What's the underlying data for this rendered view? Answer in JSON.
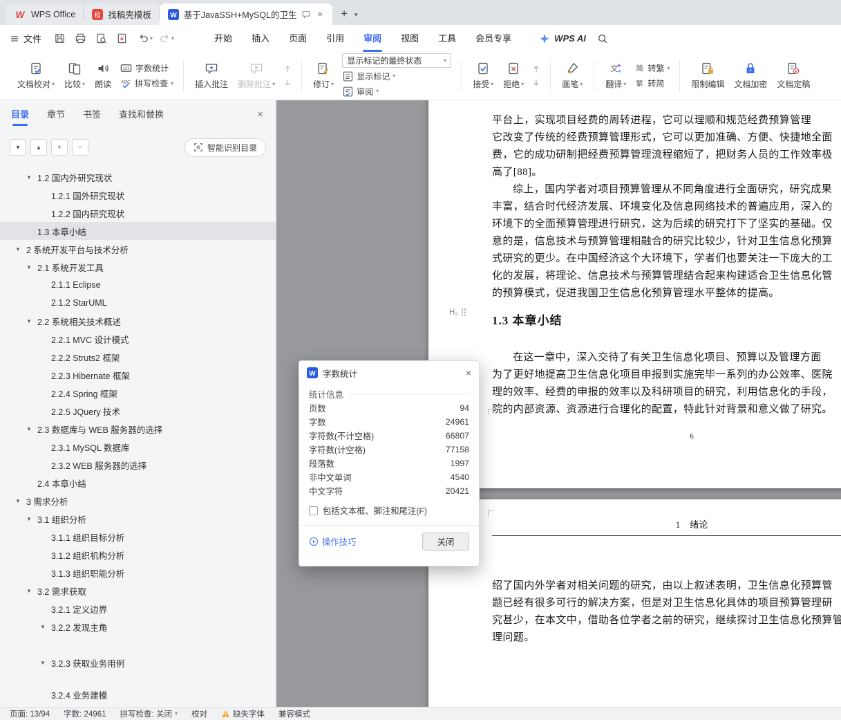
{
  "colors": {
    "accent": "#3C6EF0",
    "writer_blue": "#2A5CDC",
    "wps_red": "#E33E38",
    "warning": "#F5A623",
    "canvas": "#97999C"
  },
  "titlebar": {
    "tabs": [
      {
        "id": "wps-home",
        "icon": "wps",
        "label": "WPS Office"
      },
      {
        "id": "docer-template",
        "icon": "docer",
        "label": "找稿壳模板"
      },
      {
        "id": "document",
        "icon": "writer",
        "label": "基于JavaSSH+MySQL的卫生",
        "active": true,
        "bubble": true,
        "closable": true
      }
    ],
    "new_tab_glyph": "+",
    "tabs_chevron_glyph": "▾"
  },
  "menubar": {
    "file_label": "文件",
    "quick": [
      "save",
      "print",
      "preview",
      "export"
    ],
    "tabs": [
      {
        "label": "开始"
      },
      {
        "label": "插入"
      },
      {
        "label": "页面"
      },
      {
        "label": "引用"
      },
      {
        "label": "审阅",
        "active": true
      },
      {
        "label": "视图"
      },
      {
        "label": "工具"
      },
      {
        "label": "会员专享"
      }
    ],
    "wps_ai_label": "WPS AI"
  },
  "ribbon": {
    "groups": [
      {
        "blocks": [
          {
            "t": "big",
            "icon": "proof",
            "label": "文档校对",
            "chev": true
          },
          {
            "t": "big",
            "icon": "compare",
            "label": "比较",
            "chev": true
          },
          {
            "t": "big",
            "icon": "speaker",
            "label": "朗读"
          },
          {
            "t": "stack",
            "rows": [
              {
                "icon": "count",
                "label": "字数统计"
              },
              {
                "icon": "spell",
                "label": "拼写检查",
                "chev": true
              }
            ]
          }
        ]
      },
      {
        "blocks": [
          {
            "t": "big",
            "icon": "bubble-add",
            "label": "插入批注"
          },
          {
            "t": "big",
            "icon": "bubble-del",
            "label": "删除批注",
            "chev": true,
            "disabled": true
          },
          {
            "t": "navpair",
            "icons": [
              "prev-comment",
              "next-comment"
            ]
          }
        ]
      },
      {
        "blocks": [
          {
            "t": "big",
            "icon": "revise",
            "label": "修订",
            "chev": true
          },
          {
            "t": "stack",
            "rows": [
              {
                "combo": true,
                "label": "显示标记的最终状态"
              },
              {
                "icon": "markup",
                "label": "显示标记",
                "chev": true
              },
              {
                "icon": "review",
                "label": "审阅",
                "chev": true
              }
            ]
          }
        ]
      },
      {
        "blocks": [
          {
            "t": "big",
            "icon": "accept",
            "label": "接受",
            "chev": true
          },
          {
            "t": "big",
            "icon": "reject",
            "label": "拒绝",
            "chev": true
          },
          {
            "t": "navpair",
            "icons": [
              "prev-change",
              "next-change"
            ]
          }
        ]
      },
      {
        "blocks": [
          {
            "t": "big",
            "icon": "brush",
            "label": "画笔",
            "chev": true
          }
        ]
      },
      {
        "blocks": [
          {
            "t": "big",
            "icon": "translate",
            "label": "翻译",
            "chev": true
          },
          {
            "t": "stack",
            "rows": [
              {
                "icon": "zh-jian",
                "label": "转繁",
                "chev": true
              },
              {
                "icon": "zh-fan",
                "label": "转简"
              }
            ]
          }
        ]
      },
      {
        "blocks": [
          {
            "t": "big",
            "icon": "restrict",
            "label": "限制编辑"
          },
          {
            "t": "big",
            "icon": "encrypt",
            "label": "文档加密"
          },
          {
            "t": "big",
            "icon": "final",
            "label": "文档定稿"
          }
        ]
      }
    ]
  },
  "sidebar": {
    "tabs": [
      {
        "label": "目录",
        "active": true
      },
      {
        "label": "章节"
      },
      {
        "label": "书签"
      },
      {
        "label": "查找和替换"
      }
    ],
    "tools": [
      {
        "name": "chevron-down",
        "glyph": "▾"
      },
      {
        "name": "chevron-up",
        "glyph": "▴"
      },
      {
        "name": "plus",
        "glyph": "+"
      },
      {
        "name": "minus",
        "glyph": "−"
      }
    ],
    "smart_toc_label": "智能识别目录",
    "toc": [
      {
        "level": 2,
        "tri": true,
        "label": "1.2 国内外研究现状"
      },
      {
        "level": 3,
        "tri": false,
        "label": "1.2.1 国外研究现状"
      },
      {
        "level": 3,
        "tri": false,
        "label": "1.2.2 国内研究现状"
      },
      {
        "level": 2,
        "tri": false,
        "label": "1.3 本章小结",
        "selected": true
      },
      {
        "level": 1,
        "tri": true,
        "label": "2 系统开发平台与技术分析"
      },
      {
        "level": 2,
        "tri": true,
        "label": "2.1 系统开发工具"
      },
      {
        "level": 3,
        "tri": false,
        "label": "2.1.1 Eclipse"
      },
      {
        "level": 3,
        "tri": false,
        "label": "2.1.2 StarUML"
      },
      {
        "level": 2,
        "tri": true,
        "label": "2.2 系统相关技术概述"
      },
      {
        "level": 3,
        "tri": false,
        "label": "2.2.1 MVC 设计模式"
      },
      {
        "level": 3,
        "tri": false,
        "label": "2.2.2 Struts2 框架"
      },
      {
        "level": 3,
        "tri": false,
        "label": "2.2.3 Hibernate 框架"
      },
      {
        "level": 3,
        "tri": false,
        "label": "2.2.4 Spring 框架"
      },
      {
        "level": 3,
        "tri": false,
        "label": "2.2.5 JQuery 技术"
      },
      {
        "level": 2,
        "tri": true,
        "label": "2.3 数据库与 WEB 服务器的选择"
      },
      {
        "level": 3,
        "tri": false,
        "label": "2.3.1 MySQL 数据库"
      },
      {
        "level": 3,
        "tri": false,
        "label": "2.3.2 WEB 服务器的选择"
      },
      {
        "level": 2,
        "tri": false,
        "label": "2.4 本章小结"
      },
      {
        "level": 1,
        "tri": true,
        "label": "3 需求分析"
      },
      {
        "level": 2,
        "tri": true,
        "label": "3.1 组织分析"
      },
      {
        "level": 3,
        "tri": false,
        "label": "3.1.1 组织目标分析"
      },
      {
        "level": 3,
        "tri": false,
        "label": "3.1.2 组织机构分析"
      },
      {
        "level": 3,
        "tri": false,
        "label": "3.1.3 组织职能分析"
      },
      {
        "level": 2,
        "tri": true,
        "label": "3.2 需求获取"
      },
      {
        "level": 3,
        "tri": false,
        "label": "3.2.1 定义边界"
      },
      {
        "level": 3,
        "tri": true,
        "label": "3.2.2 发现主角"
      },
      {
        "level": 3,
        "tri": true,
        "label": "3.2.3 获取业务用例",
        "gap": 26
      },
      {
        "level": 3,
        "tri": false,
        "label": "3.2.4 业务建模",
        "gap": 20
      }
    ]
  },
  "document": {
    "page1": {
      "para1": [
        "平台上，实现项目经费的周转进程，它可以理顺和规范经费预算管理",
        "它改变了传统的经费预算管理形式，它可以更加准确、方便、快捷地全面",
        "费，它的成功研制把经费预算管理流程缩短了，把财务人员的工作效率极",
        "高了[88]。"
      ],
      "para2": [
        "综上，国内学者对项目预算管理从不同角度进行全面研究，研究成果",
        "丰富，结合时代经济发展、环境变化及信息网络技术的普遍应用，深入的",
        "环境下的全面预算管理进行研究，这为后续的研究打下了坚实的基础。仅",
        "意的是，信息技术与预算管理相融合的研究比较少，针对卫生信息化预算",
        "式研究的更少。在中国经济这个大环境下，学者们也要关注一下庞大的工",
        "化的发展，将理论、信息技术与预算管理结合起来构建适合卫生信息化管",
        "的预算模式，促进我国卫生信息化预算管理水平整体的提高。"
      ],
      "heading_marker": "H₂",
      "heading": "1.3 本章小结",
      "para3": [
        "在这一章中，深入交待了有关卫生信息化项目、预算以及管理方面",
        "为了更好地提高卫生信息化项目申报到实施完毕一系列的办公效率、医院",
        "理的效率、经费的申报的效率以及科研项目的研究，利用信息化的手段，",
        "院的内部资源、资源进行合理化的配置，特此针对背景和意义做了研究。"
      ],
      "page_number": "6"
    },
    "page2": {
      "header_num": "1",
      "header_title": "绪论",
      "para": [
        "绍了国内外学者对相关问题的研究，由以上叙述表明，卫生信息化预算管",
        "题已经有很多可行的解决方案，但是对卫生信息化具体的项目预算管理研",
        "究甚少，在本文中，借助各位学者之前的研究，继续探讨卫生信息化预算管",
        "理问题。"
      ]
    }
  },
  "dialog": {
    "title": "字数统计",
    "section_title": "统计信息",
    "stats": [
      {
        "label": "页数",
        "value": "94"
      },
      {
        "label": "字数",
        "value": "24961"
      },
      {
        "label": "字符数(不计空格)",
        "value": "66807"
      },
      {
        "label": "字符数(计空格)",
        "value": "77158"
      },
      {
        "label": "段落数",
        "value": "1997"
      },
      {
        "label": "非中文单词",
        "value": "4540"
      },
      {
        "label": "中文字符",
        "value": "20421"
      }
    ],
    "checkbox_label": "包括文本框、脚注和尾注(F)",
    "checkbox_checked": false,
    "tips_link": "操作技巧",
    "close_button": "关闭"
  },
  "statusbar": {
    "items": [
      {
        "name": "page-indicator",
        "label": "页面: 13/94"
      },
      {
        "name": "word-count",
        "label": "字数: 24961"
      },
      {
        "name": "spellcheck-toggle",
        "label": "拼写检查: 关闭",
        "chev": true
      },
      {
        "name": "proofread",
        "label": "校对"
      },
      {
        "name": "missing-font",
        "label": "缺失字体",
        "icon": "warn"
      },
      {
        "name": "compat-mode",
        "label": "兼容模式"
      }
    ]
  }
}
